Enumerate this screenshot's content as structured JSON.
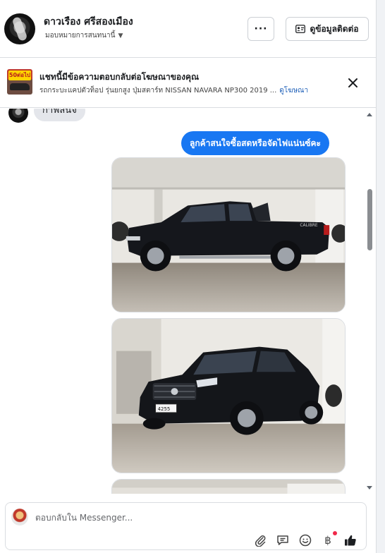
{
  "header": {
    "contact_name": "ดาวเรือง ศรีสองเมือง",
    "assign_label": "มอบหมายการสนทนานี้",
    "more_label": "···",
    "view_contact_label": "ดูข้อมูลติดต่อ"
  },
  "ad_banner": {
    "thumb_badge": "50ต่อไป",
    "title": "แชทนี้มีข้อความตอบกลับต่อโฆษณาของคุณ",
    "subtitle": "รถกระบะแคปตัวท็อป รุ่นยกสูง ปุ่มสตาร์ท NISSAN NAVARA NP300 2019 ...",
    "link_label": "ดูโฆษณา"
  },
  "chat": {
    "incoming_partial": "กาฟสนจ",
    "outgoing_message": "ลูกค้าสนใจซื้อสดหรือจัดไฟแน่นซ์คะ",
    "photo1": {
      "plate_text": "CALIBRE"
    },
    "photo2": {
      "plate_text": "4255"
    }
  },
  "composer": {
    "placeholder": "ตอบกลับใน Messenger...",
    "baht_symbol": "฿"
  },
  "colors": {
    "accent": "#1877f2",
    "link": "#1d5fb8",
    "bubble_in": "#e4e6eb",
    "notify_dot": "#f02849"
  },
  "icons": [
    "attachment-icon",
    "saved-replies-icon",
    "emoji-icon",
    "payment-icon",
    "like-icon",
    "close-icon",
    "contact-card-icon",
    "chevron-down-icon"
  ]
}
